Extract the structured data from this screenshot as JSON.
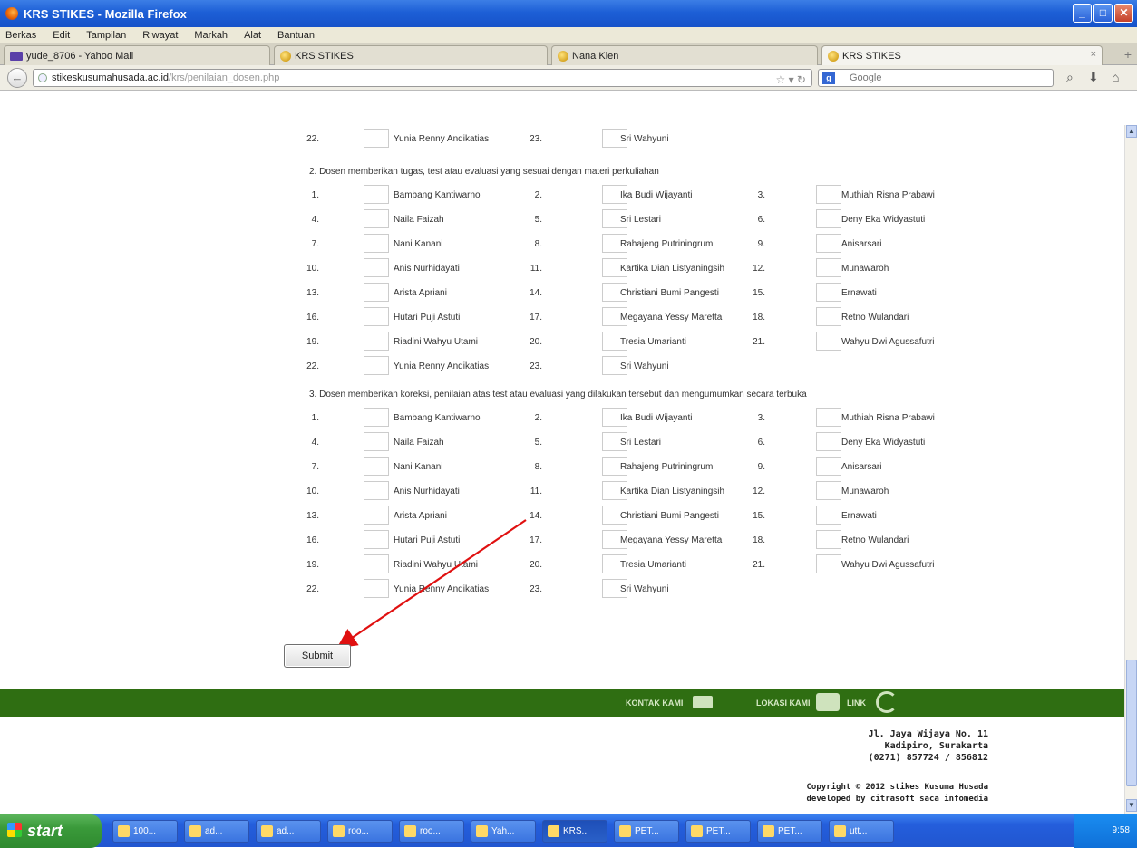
{
  "window": {
    "title": "KRS STIKES - Mozilla Firefox"
  },
  "menu": [
    "Berkas",
    "Edit",
    "Tampilan",
    "Riwayat",
    "Markah",
    "Alat",
    "Bantuan"
  ],
  "tabs": [
    {
      "label": "yude_8706 - Yahoo Mail"
    },
    {
      "label": "KRS STIKES"
    },
    {
      "label": "Nana Klen"
    },
    {
      "label": "KRS STIKES"
    }
  ],
  "address": {
    "host": "stikeskusumahusada.ac.id",
    "path": "/krs/penilaian_dosen.php"
  },
  "search": {
    "engine": "Google",
    "placeholder": "Google"
  },
  "top_row": [
    {
      "num": "22.",
      "name": "Yunia Renny Andikatias"
    },
    {
      "num": "23.",
      "name": "Sri Wahyuni"
    }
  ],
  "questions": [
    {
      "title": "2. Dosen memberikan tugas, test atau evaluasi yang sesuai dengan materi perkuliahan",
      "rows": [
        [
          {
            "num": "1.",
            "name": "Bambang Kantiwarno"
          },
          {
            "num": "2.",
            "name": "Ika Budi Wijayanti"
          },
          {
            "num": "3.",
            "name": "Muthiah Risna Prabawi"
          }
        ],
        [
          {
            "num": "4.",
            "name": "Naila Faizah"
          },
          {
            "num": "5.",
            "name": "Sri Lestari"
          },
          {
            "num": "6.",
            "name": "Deny Eka Widyastuti"
          }
        ],
        [
          {
            "num": "7.",
            "name": "Nani Kanani"
          },
          {
            "num": "8.",
            "name": "Rahajeng Putriningrum"
          },
          {
            "num": "9.",
            "name": "Anisarsari"
          }
        ],
        [
          {
            "num": "10.",
            "name": "Anis Nurhidayati"
          },
          {
            "num": "11.",
            "name": "Kartika Dian Listyaningsih"
          },
          {
            "num": "12.",
            "name": "Munawaroh"
          }
        ],
        [
          {
            "num": "13.",
            "name": "Arista Apriani"
          },
          {
            "num": "14.",
            "name": "Christiani Bumi Pangesti"
          },
          {
            "num": "15.",
            "name": "Ernawati"
          }
        ],
        [
          {
            "num": "16.",
            "name": "Hutari Puji Astuti"
          },
          {
            "num": "17.",
            "name": "Megayana Yessy Maretta"
          },
          {
            "num": "18.",
            "name": "Retno Wulandari"
          }
        ],
        [
          {
            "num": "19.",
            "name": "Riadini Wahyu Utami"
          },
          {
            "num": "20.",
            "name": "Tresia Umarianti"
          },
          {
            "num": "21.",
            "name": "Wahyu Dwi Agussafutri"
          }
        ],
        [
          {
            "num": "22.",
            "name": "Yunia Renny Andikatias"
          },
          {
            "num": "23.",
            "name": "Sri Wahyuni"
          }
        ]
      ]
    },
    {
      "title": "3. Dosen memberikan koreksi, penilaian atas test atau evaluasi yang dilakukan tersebut dan mengumumkan secara terbuka",
      "rows": [
        [
          {
            "num": "1.",
            "name": "Bambang Kantiwarno"
          },
          {
            "num": "2.",
            "name": "Ika Budi Wijayanti"
          },
          {
            "num": "3.",
            "name": "Muthiah Risna Prabawi"
          }
        ],
        [
          {
            "num": "4.",
            "name": "Naila Faizah"
          },
          {
            "num": "5.",
            "name": "Sri Lestari"
          },
          {
            "num": "6.",
            "name": "Deny Eka Widyastuti"
          }
        ],
        [
          {
            "num": "7.",
            "name": "Nani Kanani"
          },
          {
            "num": "8.",
            "name": "Rahajeng Putriningrum"
          },
          {
            "num": "9.",
            "name": "Anisarsari"
          }
        ],
        [
          {
            "num": "10.",
            "name": "Anis Nurhidayati"
          },
          {
            "num": "11.",
            "name": "Kartika Dian Listyaningsih"
          },
          {
            "num": "12.",
            "name": "Munawaroh"
          }
        ],
        [
          {
            "num": "13.",
            "name": "Arista Apriani"
          },
          {
            "num": "14.",
            "name": "Christiani Bumi Pangesti"
          },
          {
            "num": "15.",
            "name": "Ernawati"
          }
        ],
        [
          {
            "num": "16.",
            "name": "Hutari Puji Astuti"
          },
          {
            "num": "17.",
            "name": "Megayana Yessy Maretta"
          },
          {
            "num": "18.",
            "name": "Retno Wulandari"
          }
        ],
        [
          {
            "num": "19.",
            "name": "Riadini Wahyu Utami"
          },
          {
            "num": "20.",
            "name": "Tresia Umarianti"
          },
          {
            "num": "21.",
            "name": "Wahyu Dwi Agussafutri"
          }
        ],
        [
          {
            "num": "22.",
            "name": "Yunia Renny Andikatias"
          },
          {
            "num": "23.",
            "name": "Sri Wahyuni"
          }
        ]
      ]
    }
  ],
  "submit_label": "Submit",
  "green_bar": {
    "contact": "KONTAK KAMI",
    "location": "LOKASI KAMI",
    "link": "LINK"
  },
  "footer": {
    "addr1": "Jl. Jaya Wijaya No. 11",
    "addr2": "Kadipiro, Surakarta",
    "phone": "(0271) 857724 / 856812",
    "copyright": "Copyright © 2012 stikes Kusuma Husada",
    "dev": "developed by citrasoft saca infomedia"
  },
  "taskbar": {
    "start": "start",
    "items": [
      "100...",
      "ad...",
      "ad...",
      "roo...",
      "roo...",
      "Yah...",
      "KRS...",
      "PET...",
      "PET...",
      "PET...",
      "utt..."
    ],
    "clock": "9:58"
  },
  "colors": {
    "green_bar": "#2f6e12",
    "annotation_arrow": "#e01010",
    "titlebar": "#1d5fd6"
  }
}
